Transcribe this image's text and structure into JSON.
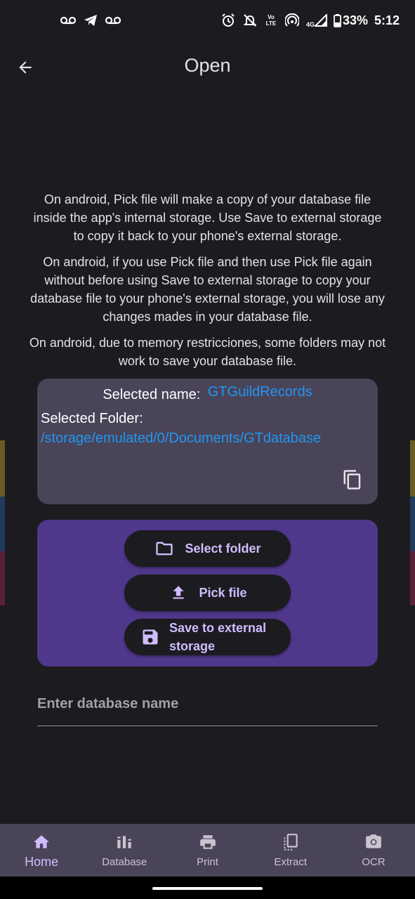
{
  "status_bar": {
    "left_icons": [
      "voicemail-icon",
      "telegram-icon",
      "voicemail-icon"
    ],
    "right_icons": [
      "alarm-icon",
      "notifications-off-icon",
      "volte-icon",
      "hotspot-icon",
      "signal-4g-icon",
      "battery-icon"
    ],
    "network": "4G",
    "volte": "LTE",
    "battery": "33%",
    "time": "5:12"
  },
  "app_bar": {
    "title": "Open",
    "back_icon": "arrow-back-icon"
  },
  "info": {
    "paragraph1": "On android, Pick file will make a copy of your database file inside the app's internal storage. Use Save to external storage to copy it back to your phone's external storage.",
    "paragraph2": "On android, if you use Pick file and then use Pick file again without before using Save to external storage to copy your database file to your phone's external storage, you will lose any changes mades in your database file.",
    "paragraph3": "On android, due to memory restricciones, some folders may not work to save your database file."
  },
  "selected": {
    "name_label": "Selected name:",
    "name_value": "GTGuildRecords",
    "folder_label": "Selected Folder:",
    "folder_value": "/storage/emulated/0/Documents/GTdatabase",
    "copy_icon": "copy-icon"
  },
  "actions": {
    "select_folder": "Select folder",
    "pick_file": "Pick file",
    "save_external": "Save to external storage"
  },
  "db_field": {
    "placeholder": "Enter database name",
    "value": ""
  },
  "nav": [
    {
      "label": "Home",
      "icon": "home-icon",
      "active": true
    },
    {
      "label": "Database",
      "icon": "database-icon",
      "active": false
    },
    {
      "label": "Print",
      "icon": "print-icon",
      "active": false
    },
    {
      "label": "Extract",
      "icon": "extract-icon",
      "active": false
    },
    {
      "label": "OCR",
      "icon": "camera-icon",
      "active": false
    }
  ],
  "colors": {
    "background": "#1c1b1f",
    "card": "#4a4458",
    "accent_card": "#4f378b",
    "accent": "#d0bcff",
    "link": "#2196f3"
  }
}
